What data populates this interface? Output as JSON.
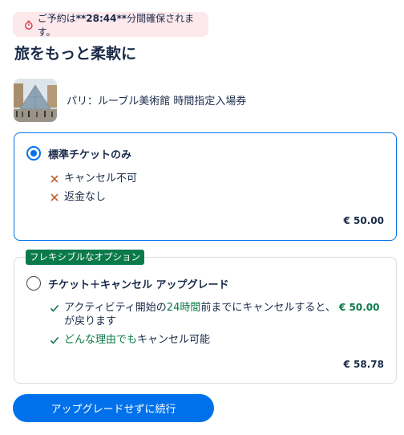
{
  "timer": {
    "text_prefix": "ご予約は",
    "time": "**28:44**",
    "text_suffix": "分間確保されます。"
  },
  "heading": "旅をもっと柔軟に",
  "product": {
    "name": "パリ：ルーブル美術館 時間指定入場券"
  },
  "options": [
    {
      "title": "標準チケットのみ",
      "selected": true,
      "features": [
        {
          "icon": "x-icon",
          "text": "キャンセル不可"
        },
        {
          "icon": "x-icon",
          "text": "返金なし"
        }
      ],
      "price": "€ 50.00"
    },
    {
      "badge": "フレキシブルなオプション",
      "title": "チケット＋キャンセル アップグレード",
      "selected": false,
      "features": [
        {
          "icon": "check-icon",
          "parts": [
            "アクティビティ開始の",
            "24時間",
            "前までにキャンセルすると、",
            "€ 50.00",
            "が戻ります"
          ]
        },
        {
          "icon": "check-icon",
          "text_green": "どんな理由でも",
          "text": "キャンセル可能"
        }
      ],
      "price": "€ 58.78"
    }
  ],
  "cta": {
    "label": "アップグレードせずに続行"
  },
  "colors": {
    "primary": "#0071eb",
    "green": "#0a7a4b",
    "timer_bg": "#fde8ec",
    "x_icon": "#c4622d"
  }
}
